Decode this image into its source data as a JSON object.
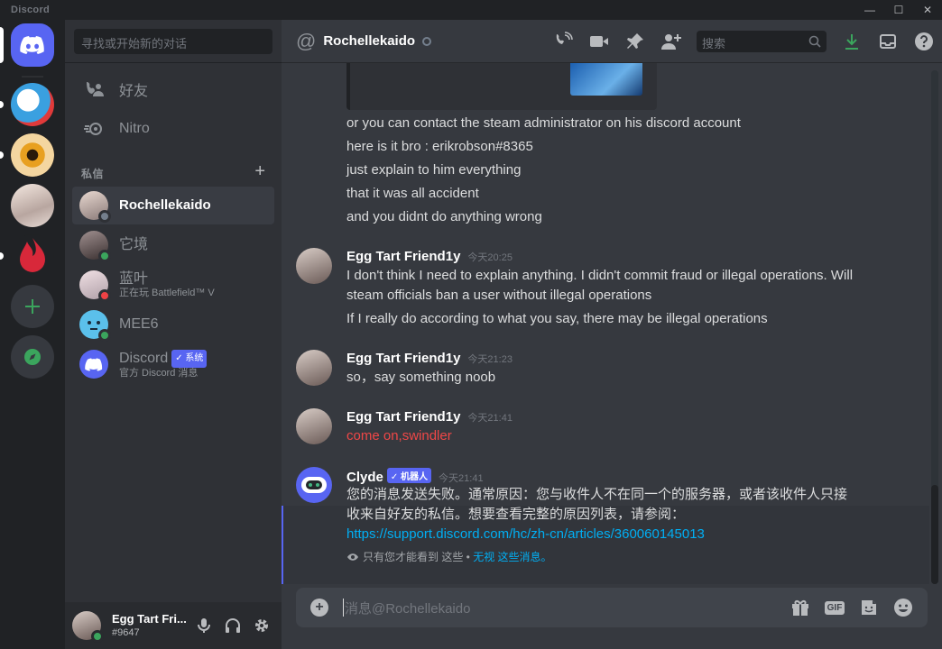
{
  "app": {
    "title": "Discord"
  },
  "window": {
    "minimize": "—",
    "maximize": "☐",
    "close": "✕"
  },
  "colors": {
    "accent": "#5865f2",
    "online": "#3ba55d",
    "dnd": "#ed4245",
    "link": "#00aff4",
    "red_text": "#f04747"
  },
  "sidebar": {
    "search_placeholder": "寻找或开始新的对话",
    "friends_label": "好友",
    "nitro_label": "Nitro",
    "dm_header": "私信",
    "dm_add": "+",
    "dms": [
      {
        "name": "Rochellekaido",
        "status": "offline"
      },
      {
        "name": "它境",
        "status": "online"
      },
      {
        "name": "蓝叶",
        "sub": "正在玩 Battlefield™ V",
        "status": "dnd"
      },
      {
        "name": "MEE6",
        "status": "online"
      },
      {
        "name": "Discord",
        "badge": "✓ 系统",
        "sub": "官方 Discord 消息"
      }
    ]
  },
  "user": {
    "name": "Egg Tart Fri...",
    "tag": "#9647"
  },
  "channel": {
    "at": "@",
    "name": "Rochellekaido",
    "search_placeholder": "搜索"
  },
  "messages": {
    "continued_lines": [
      "or you can contact the steam administrator on his discord account",
      "here is it bro : erikrobson#8365",
      "just explain to him everything",
      "that it was all accident",
      "and you didnt do anything wrong"
    ],
    "groups": [
      {
        "author": "Egg Tart Friend1y",
        "time": "今天20:25",
        "lines": [
          "I don't think I need to explain anything. I didn't commit fraud or illegal operations. Will",
          "steam officials ban a user without illegal operations",
          "If I really do according to what you say, there may be illegal operations"
        ]
      },
      {
        "author": "Egg Tart Friend1y",
        "time": "今天21:23",
        "lines": [
          "so，say something noob"
        ]
      },
      {
        "author": "Egg Tart Friend1y",
        "time": "今天21:41",
        "lines": [
          "come on,swindler"
        ]
      }
    ],
    "clyde": {
      "author": "Clyde",
      "badge": "✓ 机器人",
      "time": "今天21:41",
      "line1": "您的消息发送失败。通常原因：您与收件人不在同一个的服务器，或者该收件人只接",
      "line2": "收来自好友的私信。想要查看完整的原因列表，请参阅：",
      "link": "https://support.discord.com/hc/zh-cn/articles/360060145013",
      "ephemeral": "只有您才能看到 这些 •",
      "dismiss": "无视 这些消息。"
    }
  },
  "composer": {
    "placeholder": "消息@Rochellekaido",
    "gif": "GIF"
  }
}
